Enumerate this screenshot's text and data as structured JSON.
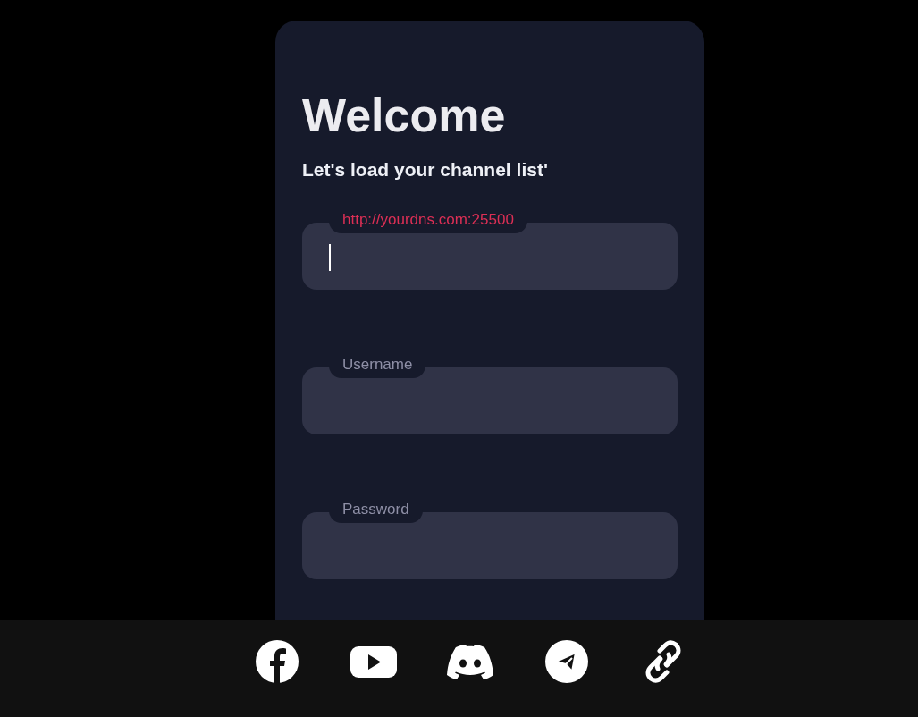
{
  "title": "Welcome",
  "subtitle": "Let's load your channel list'",
  "fields": [
    {
      "label": "http://yourdns.com:25500",
      "focused": true
    },
    {
      "label": "Username",
      "focused": false
    },
    {
      "label": "Password",
      "focused": false
    }
  ],
  "social_links": [
    {
      "kind": "facebook"
    },
    {
      "kind": "youtube"
    },
    {
      "kind": "discord"
    },
    {
      "kind": "telegram"
    },
    {
      "kind": "link"
    }
  ]
}
